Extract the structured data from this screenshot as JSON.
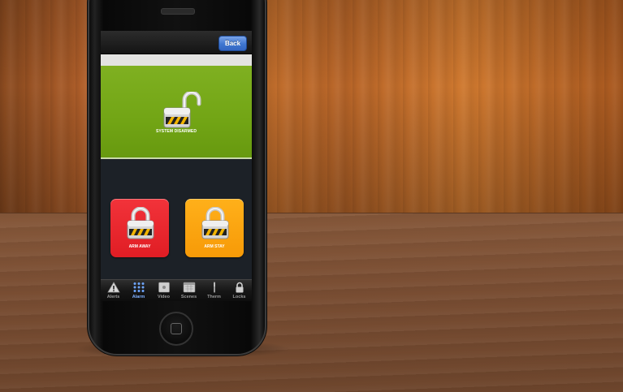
{
  "header": {
    "back_label": "Back"
  },
  "status": {
    "label": "SYSTEM DISARMED",
    "state": "disarmed",
    "color": "#72a515"
  },
  "actions": [
    {
      "label": "ARM AWAY",
      "color": "#e01d24",
      "icon": "lock-closed-icon"
    },
    {
      "label": "ARM STAY",
      "color": "#f79a07",
      "icon": "lock-closed-icon"
    }
  ],
  "tabs": [
    {
      "label": "Alerts",
      "icon": "warning-icon",
      "active": false
    },
    {
      "label": "Alarm",
      "icon": "keypad-icon",
      "active": true
    },
    {
      "label": "Video",
      "icon": "video-icon",
      "active": false
    },
    {
      "label": "Scenes",
      "icon": "calendar-icon",
      "active": false
    },
    {
      "label": "Therm",
      "icon": "thermometer-icon",
      "active": false
    },
    {
      "label": "Locks",
      "icon": "lock-icon",
      "active": false
    }
  ]
}
